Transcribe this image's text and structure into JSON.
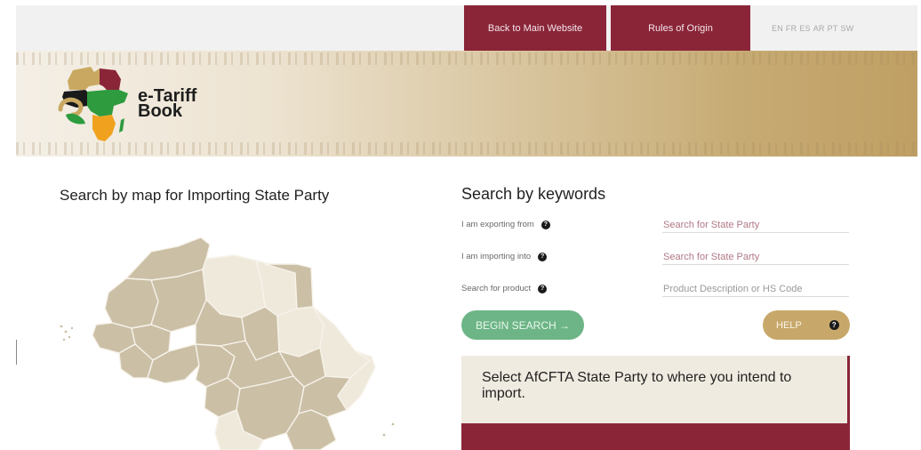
{
  "topbar": {
    "back_label": "Back to Main Website",
    "rules_label": "Rules of Origin",
    "languages": [
      "EN",
      "FR",
      "ES",
      "AR",
      "PT",
      "SW"
    ]
  },
  "banner": {
    "logo_line1": "e-Tariff",
    "logo_line2": "Book"
  },
  "map_section": {
    "title": "Search by map for Importing State Party"
  },
  "keyword_section": {
    "title": "Search by keywords",
    "exporting_label": "I am exporting from",
    "exporting_placeholder": "Search for State Party",
    "importing_label": "I am importing into",
    "importing_placeholder": "Search for State Party",
    "product_label": "Search for product",
    "product_placeholder": "Product Description or HS Code",
    "begin_label": "BEGIN SEARCH →",
    "help_label": "HELP",
    "question_glyph": "?"
  },
  "info": {
    "text": "Select AfCFTA State Party to where you intend to import."
  },
  "colors": {
    "maroon": "#8a2538",
    "green": "#6db586",
    "gold": "#c8a86a",
    "map_fill": "#cbbfa6",
    "map_light": "#efe9dc"
  }
}
